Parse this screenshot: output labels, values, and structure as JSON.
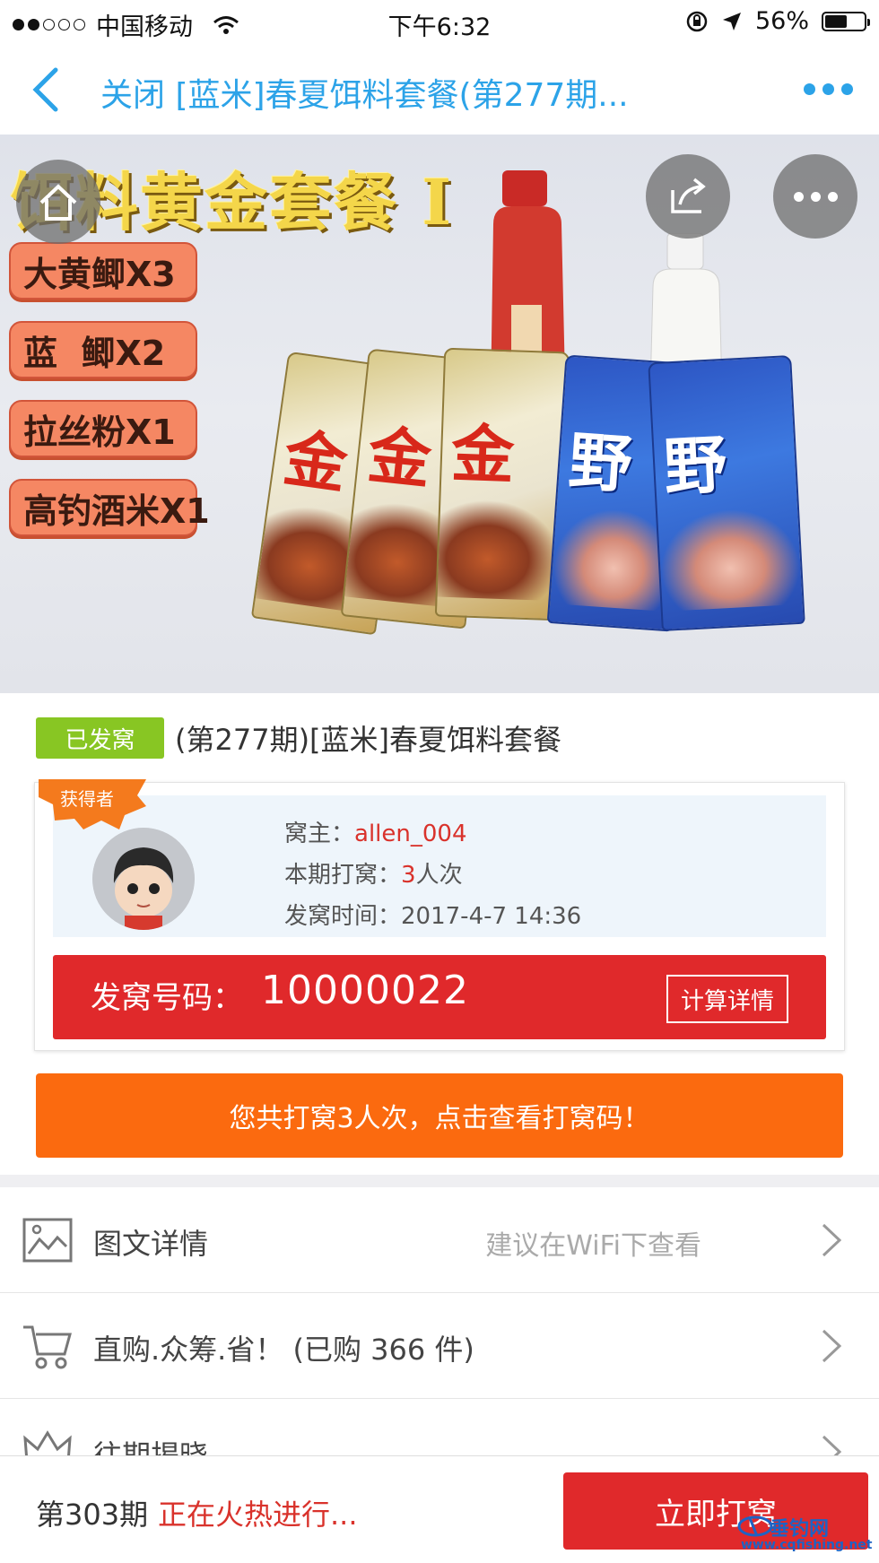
{
  "status_bar": {
    "carrier": "中国移动",
    "time": "下午6:32",
    "battery_pct": "56%",
    "battery_level": 0.56,
    "signal_bars": 2
  },
  "nav": {
    "title": "关闭 [蓝米]春夏饵料套餐(第277期..."
  },
  "hero": {
    "heading": "饵料黄金套餐 I",
    "tags": [
      "大黄鲫X3",
      "蓝  鲫X2",
      "拉丝粉X1",
      "高钓酒米X1"
    ],
    "gold_packet_text": "金",
    "blue_packet_text": "野"
  },
  "product": {
    "status_tag": "已发窝",
    "title": "(第277期)[蓝米]春夏饵料套餐"
  },
  "winner": {
    "ribbon": "获得者",
    "owner_label": "窝主：",
    "owner_name": "allen_004",
    "times_label": "本期打窝：",
    "times_value": "3",
    "times_unit": "人次",
    "time_label": "发窝时间：",
    "time_value": "2017-4-7 14:36",
    "code_label": "发窝号码：",
    "code_value": "10000022",
    "calc_button": "计算详情"
  },
  "view_codes_button": "您共打窝3人次，点击查看打窝码！",
  "list": [
    {
      "icon": "image-icon",
      "label": "图文详情",
      "hint": "建议在WiFi下查看"
    },
    {
      "icon": "cart-icon",
      "label": "直购.众筹.省！ (已购 366 件)",
      "hint": ""
    },
    {
      "icon": "crown-icon",
      "label": "往期揭晓",
      "hint": ""
    }
  ],
  "bottom_bar": {
    "period": "第303期",
    "status": "正在火热进行...",
    "join_button": "立即打窝",
    "watermark": "垂钓网",
    "watermark_url": "www.cqfishing.net"
  },
  "colors": {
    "nav_blue": "#2ca3e8",
    "red": "#e0292b",
    "orange": "#fb6a0f",
    "green": "#88c623"
  }
}
